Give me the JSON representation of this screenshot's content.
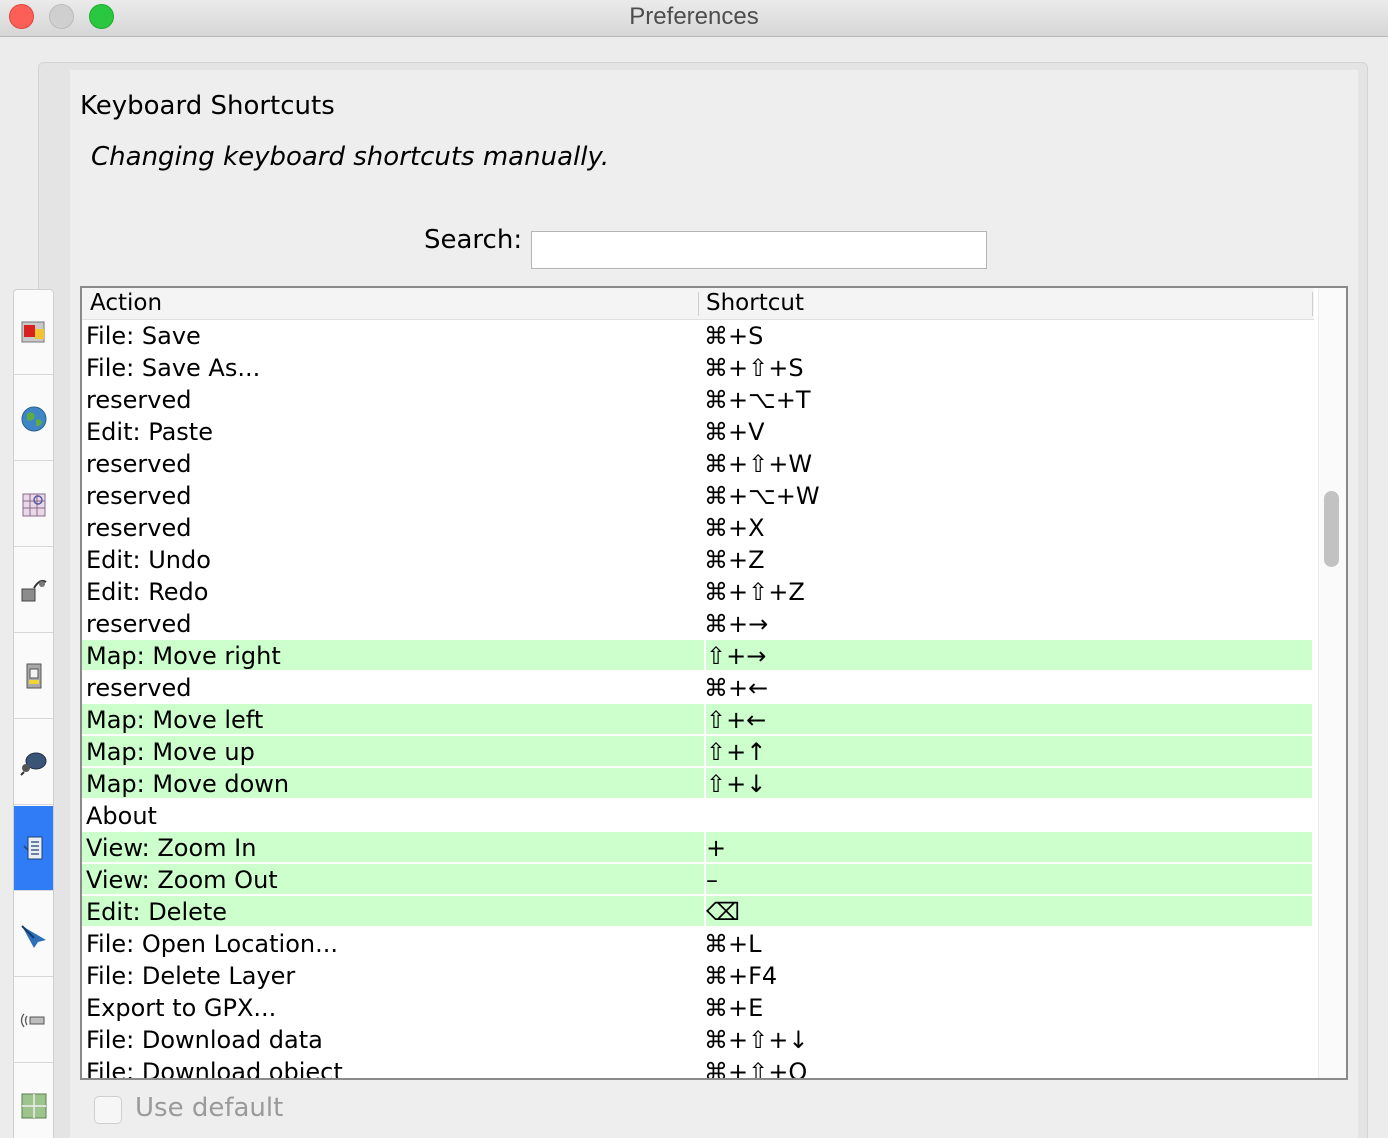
{
  "window": {
    "title": "Preferences"
  },
  "header": {
    "title": "Keyboard Shortcuts",
    "subtitle": "Changing keyboard shortcuts manually."
  },
  "search": {
    "label": "Search:",
    "value": "",
    "placeholder": ""
  },
  "table": {
    "columns": [
      "Action",
      "Shortcut"
    ],
    "rows": [
      {
        "action": "File: Save",
        "shortcut": "⌘+S",
        "highlight": false
      },
      {
        "action": "File: Save As...",
        "shortcut": "⌘+⇧+S",
        "highlight": false
      },
      {
        "action": "reserved",
        "shortcut": "⌘+⌥+T",
        "highlight": false
      },
      {
        "action": "Edit: Paste",
        "shortcut": "⌘+V",
        "highlight": false
      },
      {
        "action": "reserved",
        "shortcut": "⌘+⇧+W",
        "highlight": false
      },
      {
        "action": "reserved",
        "shortcut": "⌘+⌥+W",
        "highlight": false
      },
      {
        "action": "reserved",
        "shortcut": "⌘+X",
        "highlight": false
      },
      {
        "action": "Edit: Undo",
        "shortcut": "⌘+Z",
        "highlight": false
      },
      {
        "action": "Edit: Redo",
        "shortcut": "⌘+⇧+Z",
        "highlight": false
      },
      {
        "action": "reserved",
        "shortcut": "⌘+→",
        "highlight": false
      },
      {
        "action": "Map: Move right",
        "shortcut": "⇧+→",
        "highlight": true
      },
      {
        "action": "reserved",
        "shortcut": "⌘+←",
        "highlight": false
      },
      {
        "action": "Map: Move left",
        "shortcut": "⇧+←",
        "highlight": true
      },
      {
        "action": "Map: Move up",
        "shortcut": "⇧+↑",
        "highlight": true
      },
      {
        "action": "Map: Move down",
        "shortcut": "⇧+↓",
        "highlight": true
      },
      {
        "action": "About",
        "shortcut": "",
        "highlight": false
      },
      {
        "action": "View: Zoom In",
        "shortcut": "   +",
        "highlight": true
      },
      {
        "action": "View: Zoom Out",
        "shortcut": "–",
        "highlight": true
      },
      {
        "action": "Edit: Delete",
        "shortcut": "⌫",
        "highlight": true
      },
      {
        "action": "File: Open Location...",
        "shortcut": "⌘+L",
        "highlight": false
      },
      {
        "action": "File: Delete Layer",
        "shortcut": "⌘+F4",
        "highlight": false
      },
      {
        "action": "Export to GPX...",
        "shortcut": "⌘+E",
        "highlight": false
      },
      {
        "action": "File: Download data",
        "shortcut": "⌘+⇧+↓",
        "highlight": false
      },
      {
        "action": "File: Download object",
        "shortcut": "⌘+⇧+O",
        "highlight": false
      }
    ]
  },
  "sidebar": {
    "items": [
      {
        "icon": "display-prefs-icon"
      },
      {
        "icon": "globe-icon"
      },
      {
        "icon": "map-grid-icon"
      },
      {
        "icon": "plugin-icon"
      },
      {
        "icon": "projection-icon"
      },
      {
        "icon": "remote-control-icon"
      },
      {
        "icon": "keyboard-icon",
        "active": true
      },
      {
        "icon": "validator-icon"
      },
      {
        "icon": "audio-icon"
      },
      {
        "icon": "wms-tms-icon"
      }
    ]
  },
  "footer": {
    "use_default_label": "Use default",
    "use_default_checked": false
  },
  "colors": {
    "highlight": "#ccffcc",
    "active_sidebar": "#2f7cf6"
  }
}
